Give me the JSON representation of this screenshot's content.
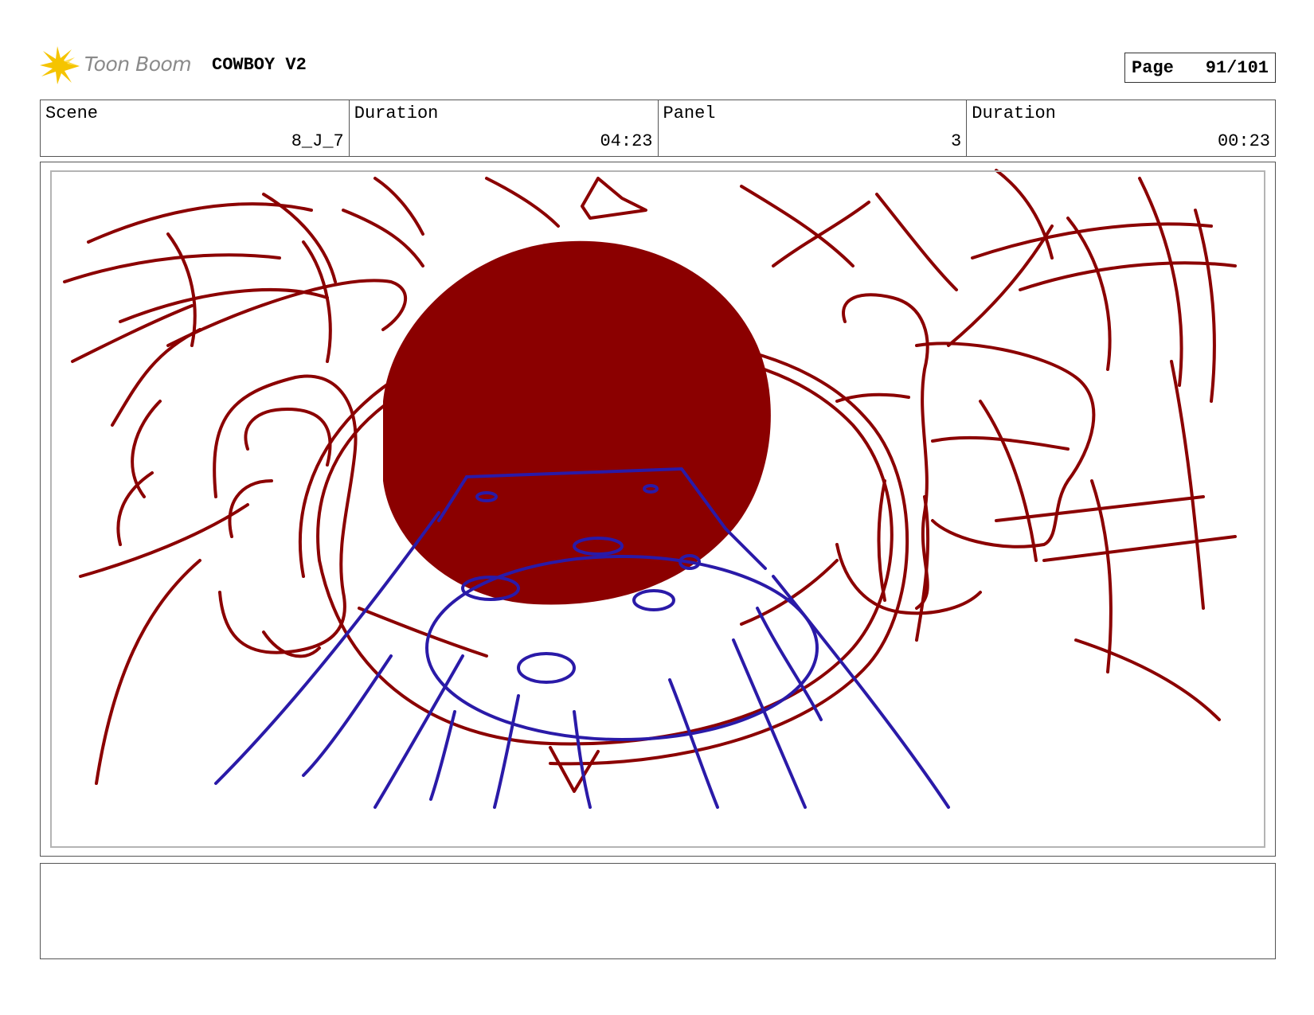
{
  "header": {
    "logo_text": "Toon Boom",
    "project_title": "COWBOY V2",
    "page_label": "Page",
    "page_number": "91/101"
  },
  "info": {
    "scene_label": "Scene",
    "scene_value": "8_J_7",
    "scene_duration_label": "Duration",
    "scene_duration_value": "04:23",
    "panel_label": "Panel",
    "panel_value": "3",
    "panel_duration_label": "Duration",
    "panel_duration_value": "00:23"
  },
  "notes": {
    "text": ""
  },
  "colors": {
    "sketch_red": "#8b0000",
    "sketch_blue": "#2a1aa8",
    "logo_yellow": "#f5c400",
    "frame_gray": "#b4b4b4"
  },
  "icons": {
    "logo": "toon-boom-star-icon"
  }
}
